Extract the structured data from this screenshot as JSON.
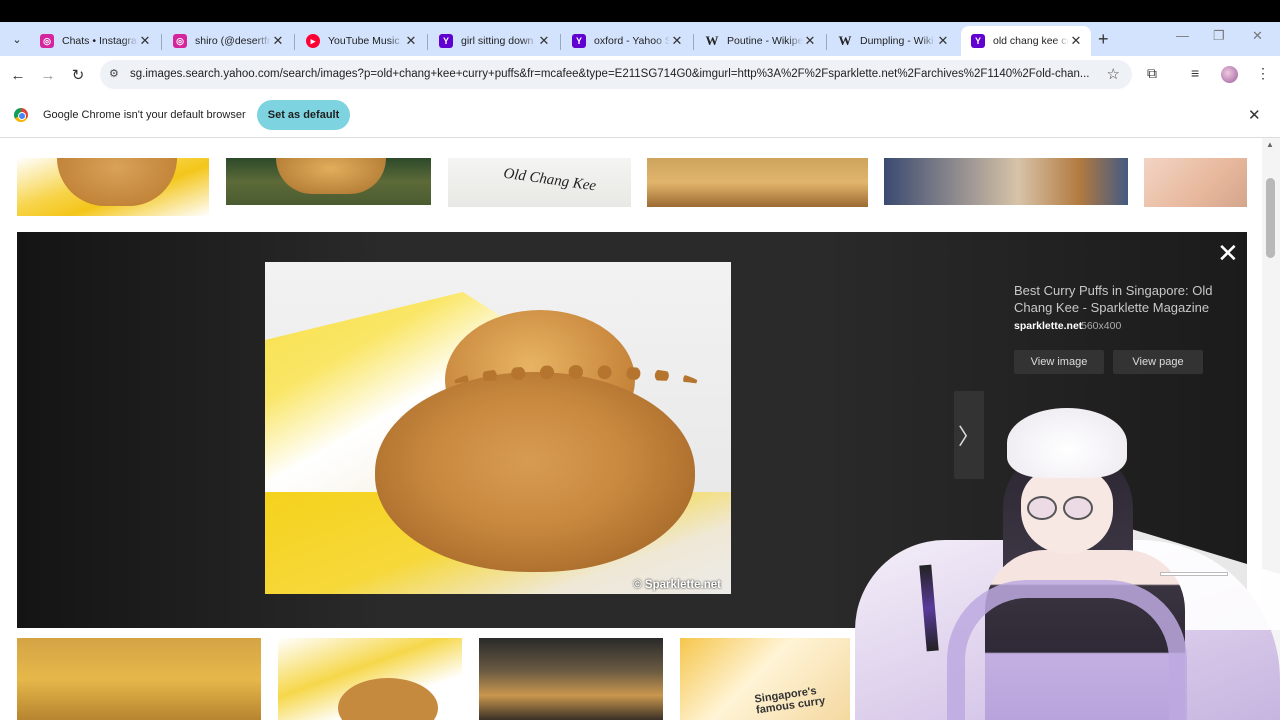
{
  "browser": {
    "tabs": [
      {
        "title": "Chats • Instagram",
        "favicon": "instagram-icon",
        "color": "#d6249f"
      },
      {
        "title": "shiro (@desertfro",
        "favicon": "instagram-icon",
        "color": "#d6249f"
      },
      {
        "title": "YouTube Music",
        "favicon": "youtube-music-icon",
        "color": "#ff0033"
      },
      {
        "title": "girl sitting down",
        "favicon": "yahoo-icon",
        "color": "#6001d2"
      },
      {
        "title": "oxford - Yahoo S",
        "favicon": "yahoo-icon",
        "color": "#6001d2"
      },
      {
        "title": "Poutine - Wikipe",
        "favicon": "wikipedia-icon",
        "color": "#ffffff"
      },
      {
        "title": "Dumpling - Wiki",
        "favicon": "wikipedia-icon",
        "color": "#ffffff"
      },
      {
        "title": "old chang kee cu",
        "favicon": "yahoo-icon",
        "color": "#6001d2",
        "active": true
      }
    ],
    "new_tab_symbol": "+",
    "address": "sg.images.search.yahoo.com/search/images?p=old+chang+kee+curry+puffs&fr=mcafee&type=E211SG714G0&imgurl=http%3A%2F%2Fsparklette.net%2Farchives%2F1140%2Fold-chan...",
    "tab_strip_color": "#d3e3fd"
  },
  "infobar": {
    "message": "Google Chrome isn't your default browser",
    "button": "Set as default",
    "button_color": "#7dd4e0"
  },
  "lightbox": {
    "title": "Best Curry Puffs in Singapore: Old Chang Kee - Sparklette Magazine",
    "source": "sparklette.net",
    "size": "560x400",
    "view_image": "View image",
    "view_page": "View page",
    "image_watermark": "© Sparklette.net"
  },
  "thumbnails_top": [
    {
      "name": "curry-puff-bag-thumb"
    },
    {
      "name": "curry-puffs-basket-thumb"
    },
    {
      "name": "old-chang-kee-bag-thumb",
      "text": "Old Chang Kee"
    },
    {
      "name": "curry-puffs-tray-thumb"
    },
    {
      "name": "curry-puff-plate-thumb"
    },
    {
      "name": "person-thumb"
    }
  ],
  "thumbnails_bottom": [
    {
      "name": "curry-puffs-pile-thumb"
    },
    {
      "name": "curry-puff-packet-thumb"
    },
    {
      "name": "curry-puffs-oven-thumb"
    },
    {
      "name": "singapore-curry-puff-thumb",
      "text": "Singapore's famous curry"
    }
  ]
}
